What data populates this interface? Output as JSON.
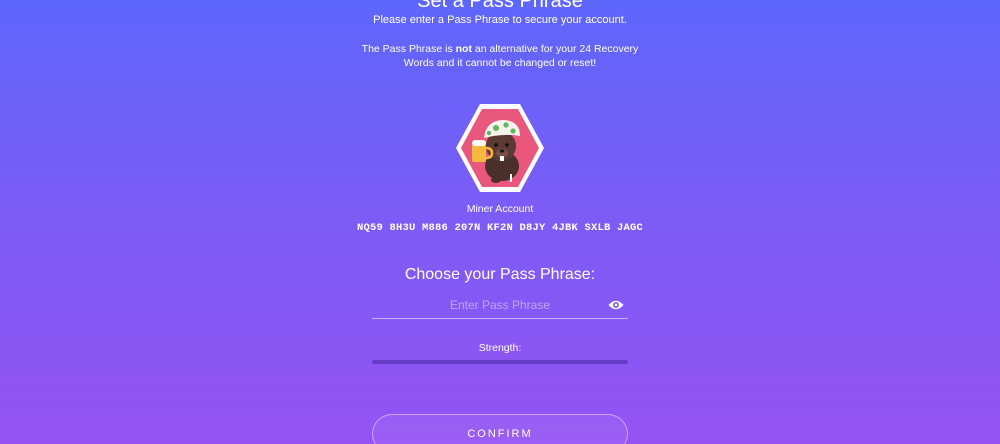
{
  "header": {
    "title": "Set a Pass Phrase",
    "subtitle": "Please enter a Pass Phrase to secure your account.",
    "warning_prefix": "The Pass Phrase is ",
    "warning_bold": "not",
    "warning_suffix": " an alternative for your 24 Recovery Words and it cannot be changed or reset!"
  },
  "account": {
    "avatar_icon": "beaver-miner-avatar-icon",
    "label": "Miner Account",
    "address": "NQ59 8H3U M886 207N KF2N D8JY 4JBK SXLB JAGC"
  },
  "pass_phrase": {
    "heading": "Choose your Pass Phrase:",
    "placeholder": "Enter Pass Phrase",
    "value": "",
    "toggle_icon": "eye-icon",
    "strength_label": "Strength:",
    "strength": 0
  },
  "actions": {
    "confirm_label": "CONFIRM"
  },
  "colors": {
    "gradient_top": "#5d66fb",
    "gradient_bottom": "#9553f3",
    "avatar_bg": "#e9577d"
  }
}
